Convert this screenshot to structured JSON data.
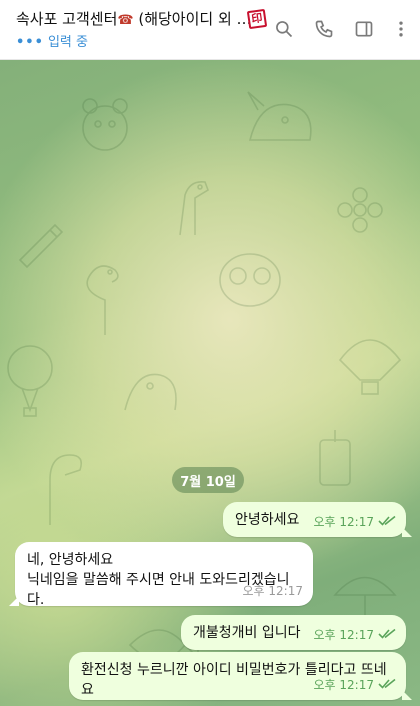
{
  "header": {
    "title": "속사포 고객센터",
    "title_badge": "☎",
    "title_suffix": " (해당아이디 외 …",
    "seal_text": "印",
    "status_dots": "•••",
    "status_text": "입력 중",
    "icons": [
      "search-icon",
      "phone-icon",
      "sidebar-toggle-icon",
      "more-vertical-icon"
    ]
  },
  "chat": {
    "date": "7월 10일",
    "messages": [
      {
        "direction": "out",
        "text": "안녕하세요",
        "time": "오후 12:17",
        "read": true
      },
      {
        "direction": "in",
        "line1": "네, 안녕하세요",
        "line2": "닉네임을 말씀해 주시면 안내 도와드리겠습니다.",
        "time": "오후 12:17"
      },
      {
        "direction": "out",
        "text": "개불청개비 입니다",
        "time": "오후 12:17",
        "read": true
      },
      {
        "direction": "out",
        "text": "환전신청 누르니깐 아이디 비밀번호가 틀리다고 뜨네요",
        "time": "오후 12:17",
        "read": true
      }
    ]
  },
  "colors": {
    "accent": "#3b8fd6",
    "outgoing_bubble": "#efffde",
    "incoming_bubble": "#ffffff",
    "read_check": "#5aa45a"
  }
}
